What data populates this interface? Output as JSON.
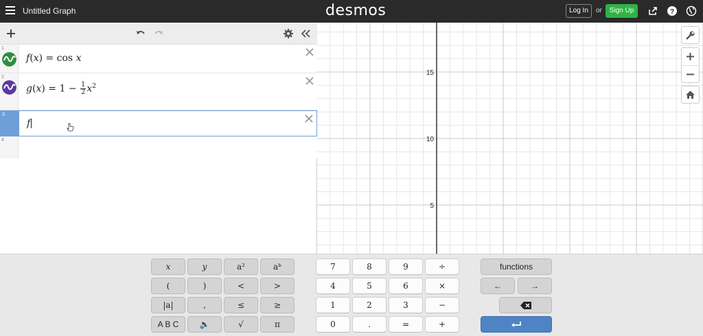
{
  "topbar": {
    "title": "Untitled Graph",
    "logo": "desmos",
    "login_label": "Log In",
    "or_label": "or",
    "signup_label": "Sign Up",
    "icons": [
      "hamburger-menu-icon",
      "share-icon",
      "help-icon",
      "globe-icon"
    ]
  },
  "expressions": [
    {
      "index": "1",
      "color": "#2d8f3f",
      "lhs": "f",
      "var": "x",
      "rhs": "cos",
      "rhs_var": "x"
    },
    {
      "index": "2",
      "color": "#5b3aa0",
      "lhs": "g",
      "var": "x",
      "one": "1",
      "minus": "−",
      "num": "1",
      "den": "2",
      "sq_var": "x",
      "exp": "2"
    },
    {
      "index": "3",
      "text": "f"
    },
    {
      "index": "4"
    }
  ],
  "graph": {
    "y_ticks": [
      "15",
      "10",
      "5"
    ],
    "grid_color": "#e6e6e6",
    "major_grid_color": "#c9c9c9",
    "axis_color": "#333333"
  },
  "keypad": {
    "left_keys": [
      [
        "x",
        "y",
        "a²",
        "aᵇ"
      ],
      [
        "(",
        ")",
        "<",
        ">"
      ],
      [
        "|a|",
        ",",
        "≤",
        "≥"
      ],
      [
        "A B C",
        "🔈",
        "√",
        "π"
      ]
    ],
    "num_keys": [
      [
        "7",
        "8",
        "9",
        "÷"
      ],
      [
        "4",
        "5",
        "6",
        "×"
      ],
      [
        "1",
        "2",
        "3",
        "−"
      ],
      [
        "0",
        ".",
        "=",
        "+"
      ]
    ],
    "functions_label": "functions",
    "left_arrow": "←",
    "right_arrow": "→"
  },
  "colors": {
    "accent": "#4f84c4",
    "signup": "#2fb344",
    "topbar": "#2a2a2a"
  }
}
